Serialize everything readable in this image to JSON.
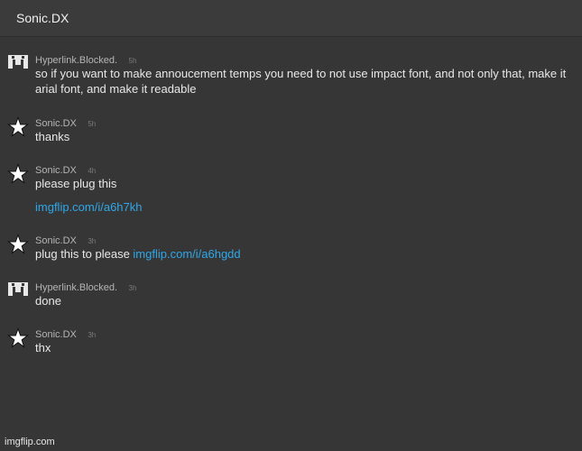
{
  "header": {
    "title": "Sonic.DX"
  },
  "messages": [
    {
      "user": "Hyperlink.Blocked.",
      "avatar": "blocky-face-icon",
      "time": "5h",
      "text": "so if you want to make annoucement temps you need to not use impact font, and not only that, make it arial font, and make it readable"
    },
    {
      "user": "Sonic.DX",
      "avatar": "star-icon",
      "time": "5h",
      "text": "thanks"
    },
    {
      "user": "Sonic.DX",
      "avatar": "star-icon",
      "time": "4h",
      "text": "please plug this",
      "link": "imgflip.com/i/a6h7kh"
    },
    {
      "user": "Sonic.DX",
      "avatar": "star-icon",
      "time": "3h",
      "text": "plug this to please ",
      "link": "imgflip.com/i/a6hgdd"
    },
    {
      "user": "Hyperlink.Blocked.",
      "avatar": "blocky-face-icon",
      "time": "3h",
      "text": "done"
    },
    {
      "user": "Sonic.DX",
      "avatar": "star-icon",
      "time": "3h",
      "text": "thx"
    }
  ],
  "watermark": "imgflip.com",
  "colors": {
    "background": "#363636",
    "link": "#2fa7e8",
    "text": "#e8e8e8",
    "username": "#b5b5b5"
  }
}
